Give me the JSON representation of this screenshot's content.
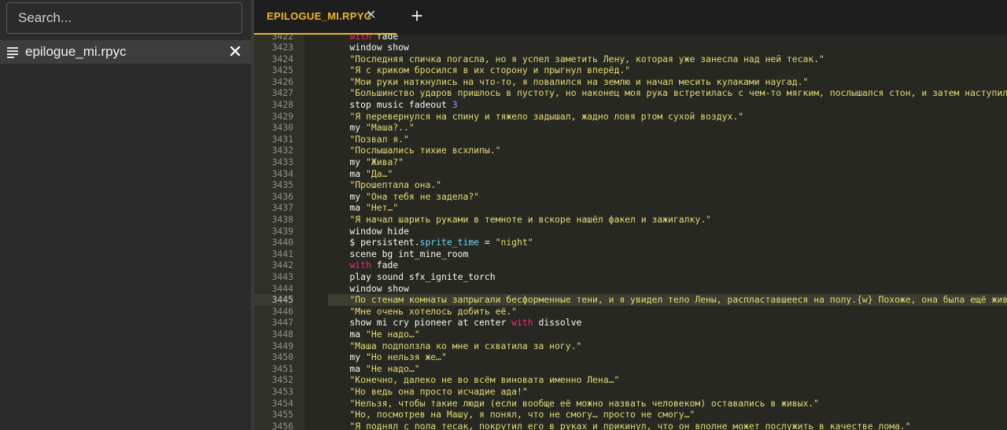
{
  "sidebar": {
    "search": {
      "placeholder": "Search...",
      "value": ""
    },
    "files": [
      {
        "name": "epilogue_mi.rpyc",
        "icon": "list-lines-icon",
        "close_icon": "close-icon"
      }
    ]
  },
  "tabs": [
    {
      "label": "EPILOGUE_MI.RPYC",
      "active": true,
      "accent": "#f0b429"
    }
  ],
  "add_tab_icon": "plus-icon",
  "colors": {
    "keyword": "#f8f8f2",
    "string": "#e6db74",
    "with": "#f92672",
    "number": "#ae81ff",
    "attribute": "#66d9ef",
    "background": "#272822"
  },
  "editor": {
    "active_line": 3445,
    "lines": [
      {
        "n": "3422",
        "tokens": [
          {
            "t": "    ",
            "c": "plain"
          },
          {
            "t": "with",
            "c": "pink"
          },
          {
            "t": " fade",
            "c": "plain"
          }
        ]
      },
      {
        "n": "3423",
        "tokens": [
          {
            "t": "    window show",
            "c": "plain"
          }
        ]
      },
      {
        "n": "3424",
        "tokens": [
          {
            "t": "    ",
            "c": "plain"
          },
          {
            "t": "\"Последняя спичка погасла, но я успел заметить Лену, которая уже занесла над ней тесак.\"",
            "c": "str"
          }
        ]
      },
      {
        "n": "3425",
        "tokens": [
          {
            "t": "    ",
            "c": "plain"
          },
          {
            "t": "\"Я с криком бросился в их сторону и прыгнул вперёд.\"",
            "c": "str"
          }
        ]
      },
      {
        "n": "3426",
        "tokens": [
          {
            "t": "    ",
            "c": "plain"
          },
          {
            "t": "\"Мои руки наткнулись на что-то, я повалился на землю и начал месить кулаками наугад.\"",
            "c": "str"
          }
        ]
      },
      {
        "n": "3427",
        "tokens": [
          {
            "t": "    ",
            "c": "plain"
          },
          {
            "t": "\"Большинство ударов пришлось в пустоту, но наконец моя рука встретилась с чем-то мягким, послышался стон, и затем наступила по",
            "c": "str"
          }
        ]
      },
      {
        "n": "3428",
        "tokens": [
          {
            "t": "    stop music fadeout ",
            "c": "plain"
          },
          {
            "t": "3",
            "c": "num"
          }
        ]
      },
      {
        "n": "3429",
        "tokens": [
          {
            "t": "    ",
            "c": "plain"
          },
          {
            "t": "\"Я перевернулся на спину и тяжело задышал, жадно ловя ртом сухой воздух.\"",
            "c": "str"
          }
        ]
      },
      {
        "n": "3430",
        "tokens": [
          {
            "t": "    my ",
            "c": "plain"
          },
          {
            "t": "\"Маша?..\"",
            "c": "str"
          }
        ]
      },
      {
        "n": "3431",
        "tokens": [
          {
            "t": "    ",
            "c": "plain"
          },
          {
            "t": "\"Позвал я.\"",
            "c": "str"
          }
        ]
      },
      {
        "n": "3432",
        "tokens": [
          {
            "t": "    ",
            "c": "plain"
          },
          {
            "t": "\"Послышались тихие всхлипы.\"",
            "c": "str"
          }
        ]
      },
      {
        "n": "3433",
        "tokens": [
          {
            "t": "    my ",
            "c": "plain"
          },
          {
            "t": "\"Жива?\"",
            "c": "str"
          }
        ]
      },
      {
        "n": "3434",
        "tokens": [
          {
            "t": "    ma ",
            "c": "plain"
          },
          {
            "t": "\"Да…\"",
            "c": "str"
          }
        ]
      },
      {
        "n": "3435",
        "tokens": [
          {
            "t": "    ",
            "c": "plain"
          },
          {
            "t": "\"Прошептала она.\"",
            "c": "str"
          }
        ]
      },
      {
        "n": "3436",
        "tokens": [
          {
            "t": "    my ",
            "c": "plain"
          },
          {
            "t": "\"Она тебя не задела?\"",
            "c": "str"
          }
        ]
      },
      {
        "n": "3437",
        "tokens": [
          {
            "t": "    ma ",
            "c": "plain"
          },
          {
            "t": "\"Нет…\"",
            "c": "str"
          }
        ]
      },
      {
        "n": "3438",
        "tokens": [
          {
            "t": "    ",
            "c": "plain"
          },
          {
            "t": "\"Я начал шарить руками в темноте и вскоре нашёл факел и зажигалку.\"",
            "c": "str"
          }
        ]
      },
      {
        "n": "3439",
        "tokens": [
          {
            "t": "    window hide",
            "c": "plain"
          }
        ]
      },
      {
        "n": "3440",
        "tokens": [
          {
            "t": "    $ persistent.",
            "c": "plain"
          },
          {
            "t": "sprite_time",
            "c": "attr"
          },
          {
            "t": " = ",
            "c": "plain"
          },
          {
            "t": "\"night\"",
            "c": "str"
          }
        ]
      },
      {
        "n": "3441",
        "tokens": [
          {
            "t": "    scene bg int_mine_room",
            "c": "plain"
          }
        ]
      },
      {
        "n": "3442",
        "tokens": [
          {
            "t": "    ",
            "c": "plain"
          },
          {
            "t": "with",
            "c": "pink"
          },
          {
            "t": " fade",
            "c": "plain"
          }
        ]
      },
      {
        "n": "3443",
        "tokens": [
          {
            "t": "    play sound sfx_ignite_torch",
            "c": "plain"
          }
        ]
      },
      {
        "n": "3444",
        "tokens": [
          {
            "t": "    window show",
            "c": "plain"
          }
        ]
      },
      {
        "n": "3445",
        "tokens": [
          {
            "t": "    ",
            "c": "plain"
          },
          {
            "t": "\"По стенам комнаты запрыгали бесформенные тени, и я увидел тело Лены, распластавшееся на полу.{w} Похоже, она была ещё жива.\"",
            "c": "str"
          }
        ]
      },
      {
        "n": "3446",
        "tokens": [
          {
            "t": "    ",
            "c": "plain"
          },
          {
            "t": "\"Мне очень хотелось добить её.\"",
            "c": "str"
          }
        ]
      },
      {
        "n": "3447",
        "tokens": [
          {
            "t": "    show mi cry pioneer at center ",
            "c": "plain"
          },
          {
            "t": "with",
            "c": "pink"
          },
          {
            "t": " dissolve",
            "c": "plain"
          }
        ]
      },
      {
        "n": "3448",
        "tokens": [
          {
            "t": "    ma ",
            "c": "plain"
          },
          {
            "t": "\"Не надо…\"",
            "c": "str"
          }
        ]
      },
      {
        "n": "3449",
        "tokens": [
          {
            "t": "    ",
            "c": "plain"
          },
          {
            "t": "\"Маша подползла ко мне и схватила за ногу.\"",
            "c": "str"
          }
        ]
      },
      {
        "n": "3450",
        "tokens": [
          {
            "t": "    my ",
            "c": "plain"
          },
          {
            "t": "\"Но нельзя же…\"",
            "c": "str"
          }
        ]
      },
      {
        "n": "3451",
        "tokens": [
          {
            "t": "    ma ",
            "c": "plain"
          },
          {
            "t": "\"Не надо…\"",
            "c": "str"
          }
        ]
      },
      {
        "n": "3452",
        "tokens": [
          {
            "t": "    ",
            "c": "plain"
          },
          {
            "t": "\"Конечно, далеко не во всём виновата именно Лена…\"",
            "c": "str"
          }
        ]
      },
      {
        "n": "3453",
        "tokens": [
          {
            "t": "    ",
            "c": "plain"
          },
          {
            "t": "\"Но ведь она просто исчадие ада!\"",
            "c": "str"
          }
        ]
      },
      {
        "n": "3454",
        "tokens": [
          {
            "t": "    ",
            "c": "plain"
          },
          {
            "t": "\"Нельзя, чтобы такие люди (если вообще её можно назвать человеком) оставались в живых.\"",
            "c": "str"
          }
        ]
      },
      {
        "n": "3455",
        "tokens": [
          {
            "t": "    ",
            "c": "plain"
          },
          {
            "t": "\"Но, посмотрев на Машу, я понял, что не смогу… просто не смогу…\"",
            "c": "str"
          }
        ]
      },
      {
        "n": "3456",
        "tokens": [
          {
            "t": "    ",
            "c": "plain"
          },
          {
            "t": "\"Я поднял с пола тесак, покрутил его в руках и прикинул, что он вполне может послужить в качестве лома.\"",
            "c": "str"
          }
        ]
      }
    ]
  }
}
